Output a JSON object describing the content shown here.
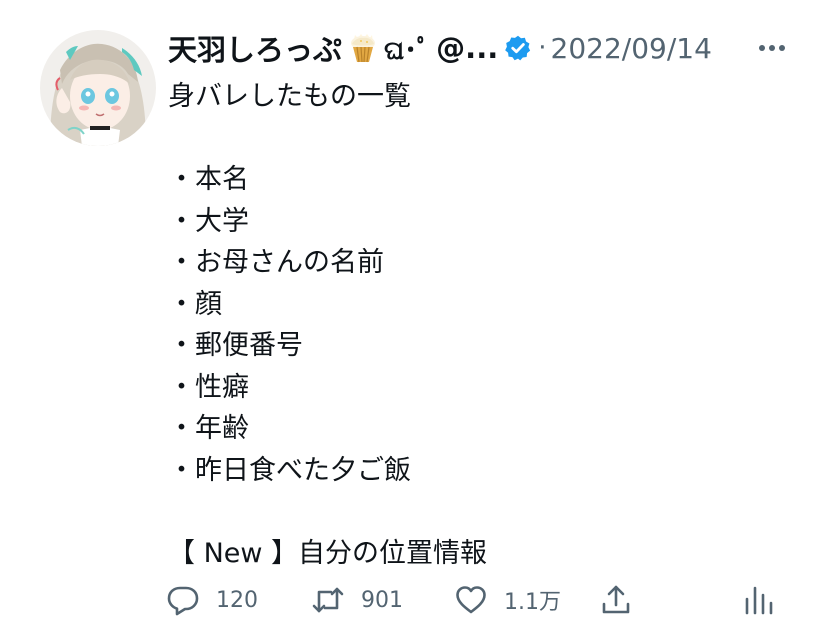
{
  "tweet": {
    "display_name": "天羽しろっぷ",
    "name_emoji": "cupcake-icon",
    "kaomoji": "ଘ･ﾟ",
    "handle": "@...",
    "separator": "·",
    "date": "2022/09/14",
    "lines": [
      "身バレしたもの一覧",
      "",
      "・本名",
      "・大学",
      "・お母さんの名前",
      "・顔",
      "・郵便番号",
      "・性癖",
      "・年齢",
      "・昨日食べた夕ご飯",
      "",
      "【 New 】自分の位置情報"
    ]
  },
  "actions": {
    "reply_count": "120",
    "retweet_count": "901",
    "like_count": "1.1万"
  },
  "icons": {
    "reply": "speech-bubble-icon",
    "retweet": "retweet-arrows-icon",
    "like": "heart-icon",
    "share": "share-upload-icon",
    "analytics": "bar-chart-icon",
    "more": "more-dots-icon",
    "verified": "verified-badge-icon"
  },
  "colors": {
    "text": "#0f1419",
    "secondary": "#536471",
    "verified": "#1d9bf0"
  }
}
